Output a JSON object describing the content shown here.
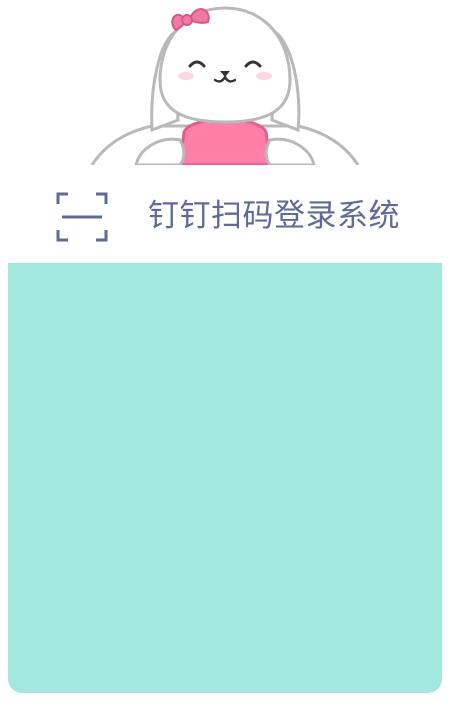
{
  "header": {
    "title": "钉钉扫码登录系统",
    "scan_icon": "qr-scan-icon"
  },
  "mascot": {
    "icon": "bunny-mascot-icon"
  },
  "colors": {
    "title": "#5d6a9a",
    "panel": "#a3e8de",
    "bow": "#f07aa3",
    "shirt": "#ff7fa8"
  }
}
